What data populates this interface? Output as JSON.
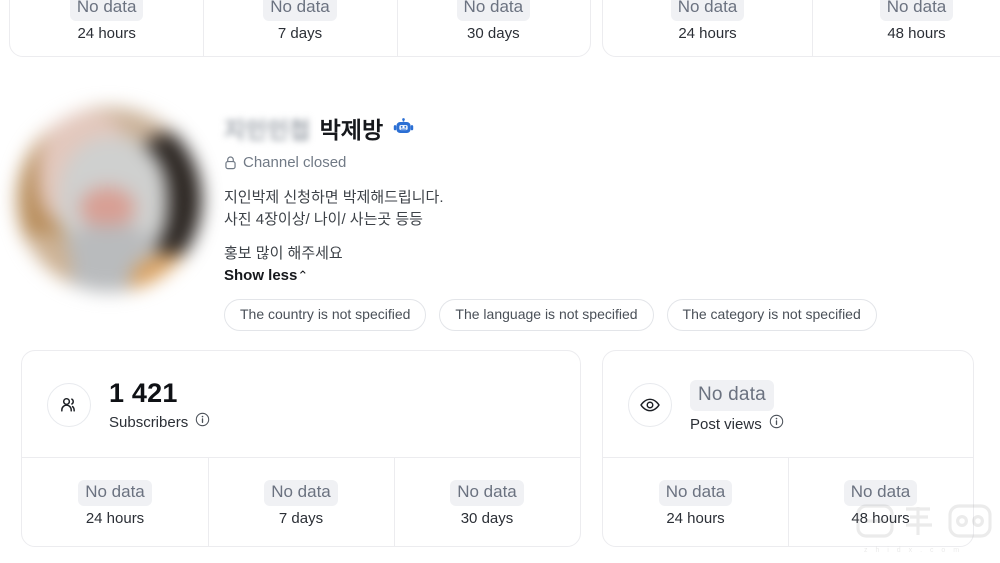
{
  "top_cards": {
    "left": {
      "segments": [
        {
          "value": "No data",
          "label": "24 hours"
        },
        {
          "value": "No data",
          "label": "7 days"
        },
        {
          "value": "No data",
          "label": "30 days"
        }
      ]
    },
    "right": {
      "segments": [
        {
          "value": "No data",
          "label": "24 hours"
        },
        {
          "value": "No data",
          "label": "48 hours"
        }
      ]
    }
  },
  "profile": {
    "avatar_alt": "channel-avatar",
    "title_blurred": "지인인첩",
    "title": "박제방",
    "verified_icon": "robot-icon",
    "status_icon": "lock-icon",
    "status": "Channel closed",
    "description_lines": [
      "지인박제 신청하면 박제해드립니다.",
      "사진 4장이상/ 나이/ 사는곳 등등"
    ],
    "promo": "홍보 많이 해주세요",
    "show_less": "Show less",
    "show_less_chevron": "⌃",
    "tags": [
      "The country is not specified",
      "The language is not specified",
      "The category is not specified"
    ]
  },
  "metrics": {
    "subscribers": {
      "icon": "people-icon",
      "value": "1 421",
      "label": "Subscribers",
      "info_icon": "info-icon",
      "segments": [
        {
          "value": "No data",
          "label": "24 hours"
        },
        {
          "value": "No data",
          "label": "7 days"
        },
        {
          "value": "No data",
          "label": "30 days"
        }
      ]
    },
    "post_views": {
      "icon": "eye-icon",
      "value": "No data",
      "label": "Post views",
      "info_icon": "info-icon",
      "segments": [
        {
          "value": "No data",
          "label": "24 hours"
        },
        {
          "value": "No data",
          "label": "48 hours"
        }
      ]
    }
  },
  "watermark": {
    "text": "z h i d x . c o m"
  },
  "colors": {
    "accent": "#2b6fd4",
    "text": "#16181c",
    "muted": "#6b7280",
    "border": "#ececef",
    "badge_bg": "#f0f1f4"
  }
}
